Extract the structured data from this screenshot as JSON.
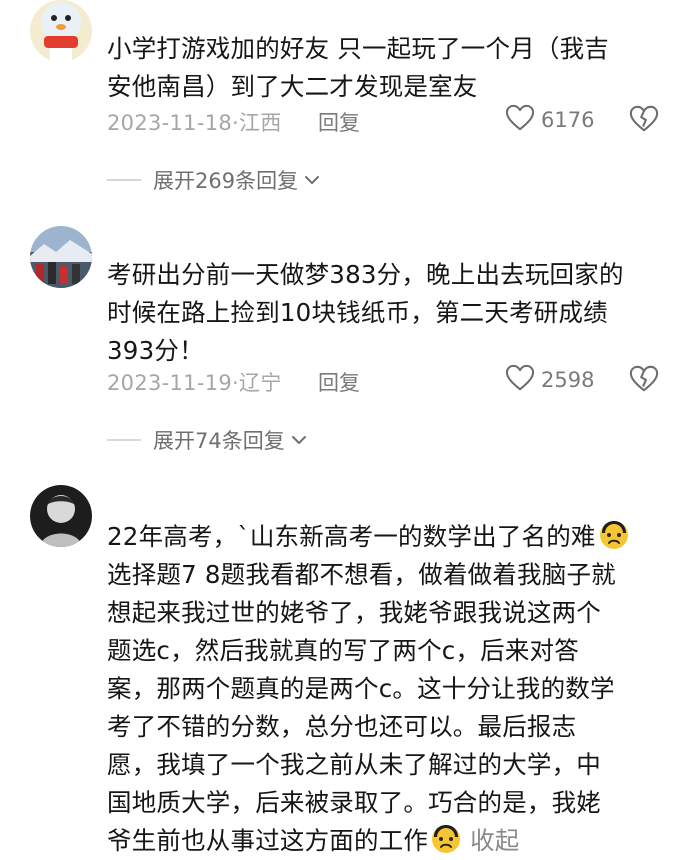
{
  "comments": [
    {
      "lines": [
        "小学打游戏加的好友 只一起玩了一个月（我吉",
        "安他南昌）到了大二才发现是室友"
      ],
      "date": "2023-11-18·江西",
      "reply_label": "回复",
      "likes": "6176",
      "expand_label": "展开269条回复"
    },
    {
      "lines": [
        "考研出分前一天做梦383分，晚上出去玩回家的",
        "时候在路上捡到10块钱纸币，第二天考研成绩",
        "393分！"
      ],
      "date": "2023-11-19·辽宁",
      "reply_label": "回复",
      "likes": "2598",
      "expand_label": "展开74条回复"
    },
    {
      "line1": "22年高考，`山东新高考一的数学出了名的难",
      "lines": [
        "选择题7 8题我看都不想看，做着做着我脑子就",
        "想起来我过世的姥爷了，我姥爷跟我说这两个",
        "题选c，然后我就真的写了两个c，后来对答",
        "案，那两个题真的是两个c。这十分让我的数学",
        "考了不错的分数，总分也还可以。最后报志",
        "愿，我填了一个我之前从未了解过的大学，中",
        "国地质大学，后来被录取了。巧合的是，我姥"
      ],
      "last_line": "爷生前也从事过这方面的工作",
      "collapse_label": "收起"
    }
  ],
  "icons": {
    "like": "heart-outline-icon",
    "dislike": "broken-heart-icon",
    "expand": "chevron-down-icon",
    "emoji": "worried-face-emoji"
  },
  "colors": {
    "text": "#161616",
    "meta": "#a6a6a6",
    "action": "#7a7a7a",
    "emoji_yellow": "#f7c531"
  }
}
